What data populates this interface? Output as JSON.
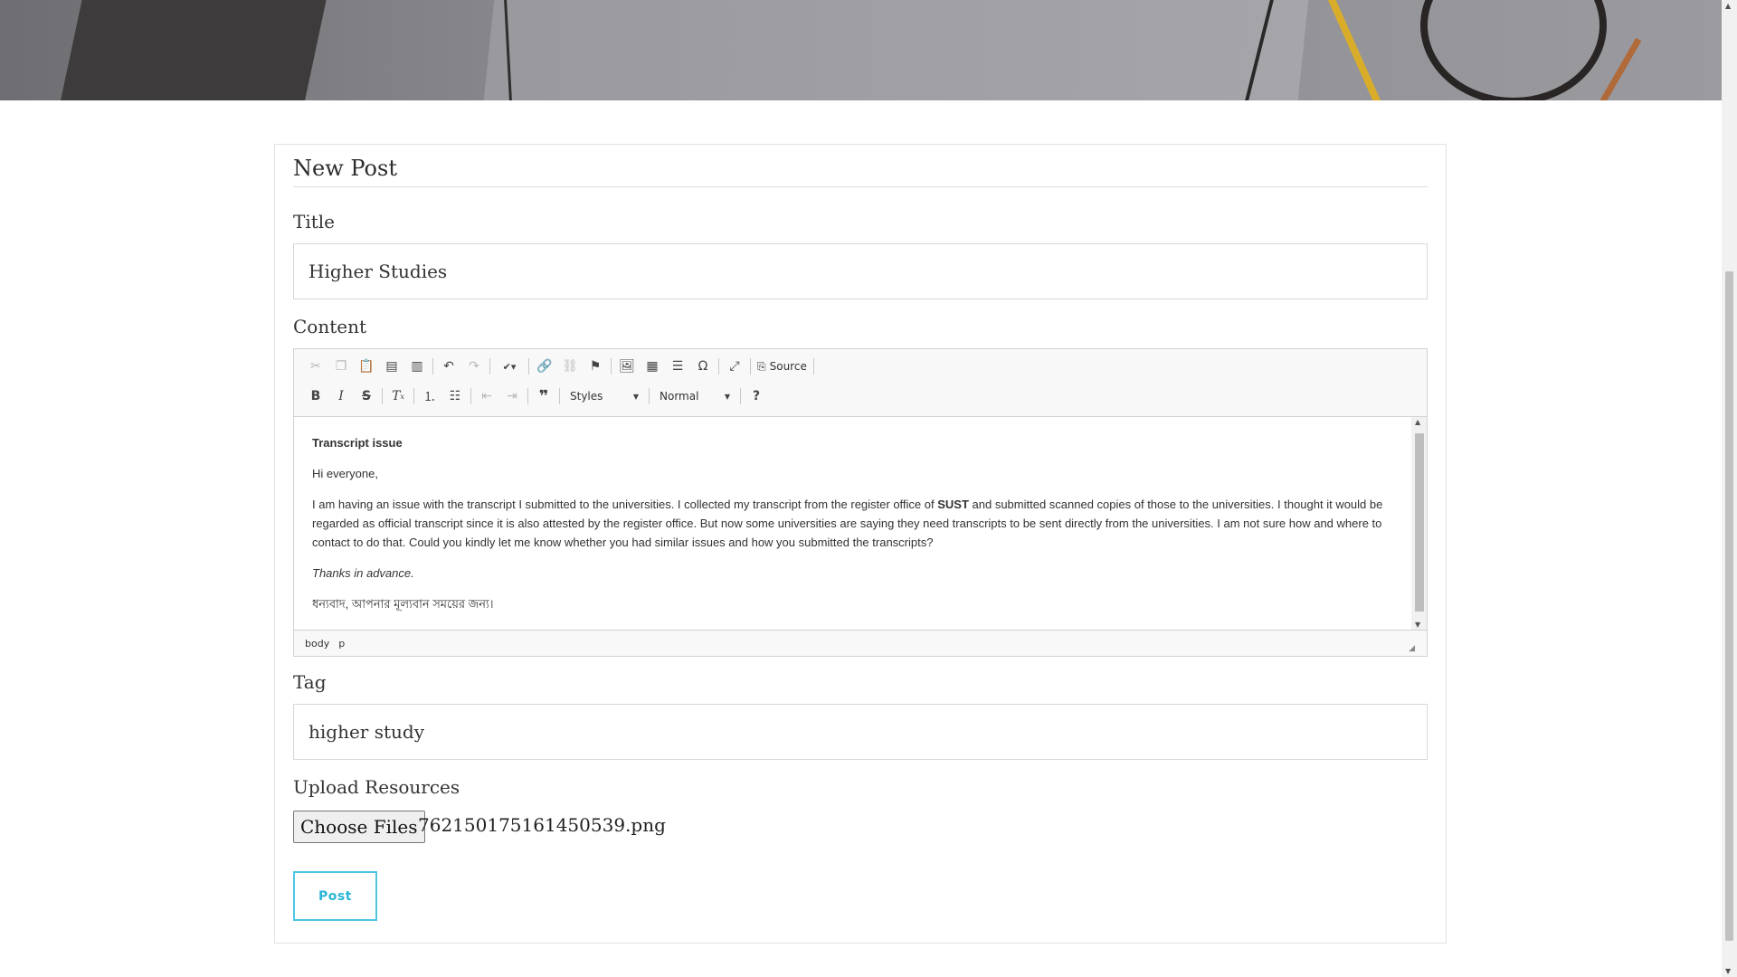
{
  "form": {
    "heading": "New Post",
    "title_label": "Title",
    "title_value": "Higher Studies",
    "content_label": "Content",
    "tag_label": "Tag",
    "tag_value": "higher study",
    "upload_label": "Upload Resources",
    "choose_files_label": "Choose Files",
    "chosen_file": "762150175161450539.png",
    "post_button": "Post"
  },
  "editor": {
    "toolbar": {
      "source_label": "Source",
      "styles_label": "Styles",
      "format_label": "Normal"
    },
    "content": {
      "heading": "Transcript issue",
      "greeting": "Hi everyone,",
      "body_before": "I am having an issue with the transcript I submitted to the universities. I collected my transcript from the register office of ",
      "body_bold": "SUST",
      "body_after": " and submitted scanned copies of those to the universities. I thought it would be regarded as official transcript since it is also attested by the register office. But now some universities are saying they need transcripts to be sent directly from the universities. I am not sure how and where to contact to do that. Could you kindly let me know whether you had similar issues and how you submitted the transcripts?",
      "closing": "Thanks in advance.",
      "bangla": "ধন্যবাদ, আপনার মূল্যবান সময়ের জন্য।"
    },
    "path": [
      "body",
      "p"
    ]
  },
  "icons": {
    "toolbar_row1": [
      "cut-icon",
      "copy-icon",
      "paste-icon",
      "paste-text-icon",
      "paste-word-icon",
      "undo-icon",
      "redo-icon",
      "spellcheck-icon",
      "link-icon",
      "unlink-icon",
      "anchor-icon",
      "image-icon",
      "table-icon",
      "horizontal-rule-icon",
      "special-char-icon",
      "maximize-icon",
      "source-icon"
    ],
    "toolbar_row2": [
      "bold-icon",
      "italic-icon",
      "strike-icon",
      "remove-format-icon",
      "numbered-list-icon",
      "bulleted-list-icon",
      "outdent-icon",
      "indent-icon",
      "blockquote-icon",
      "help-icon"
    ]
  },
  "colors": {
    "accent": "#29b5d7",
    "border": "#d8d8d8"
  }
}
